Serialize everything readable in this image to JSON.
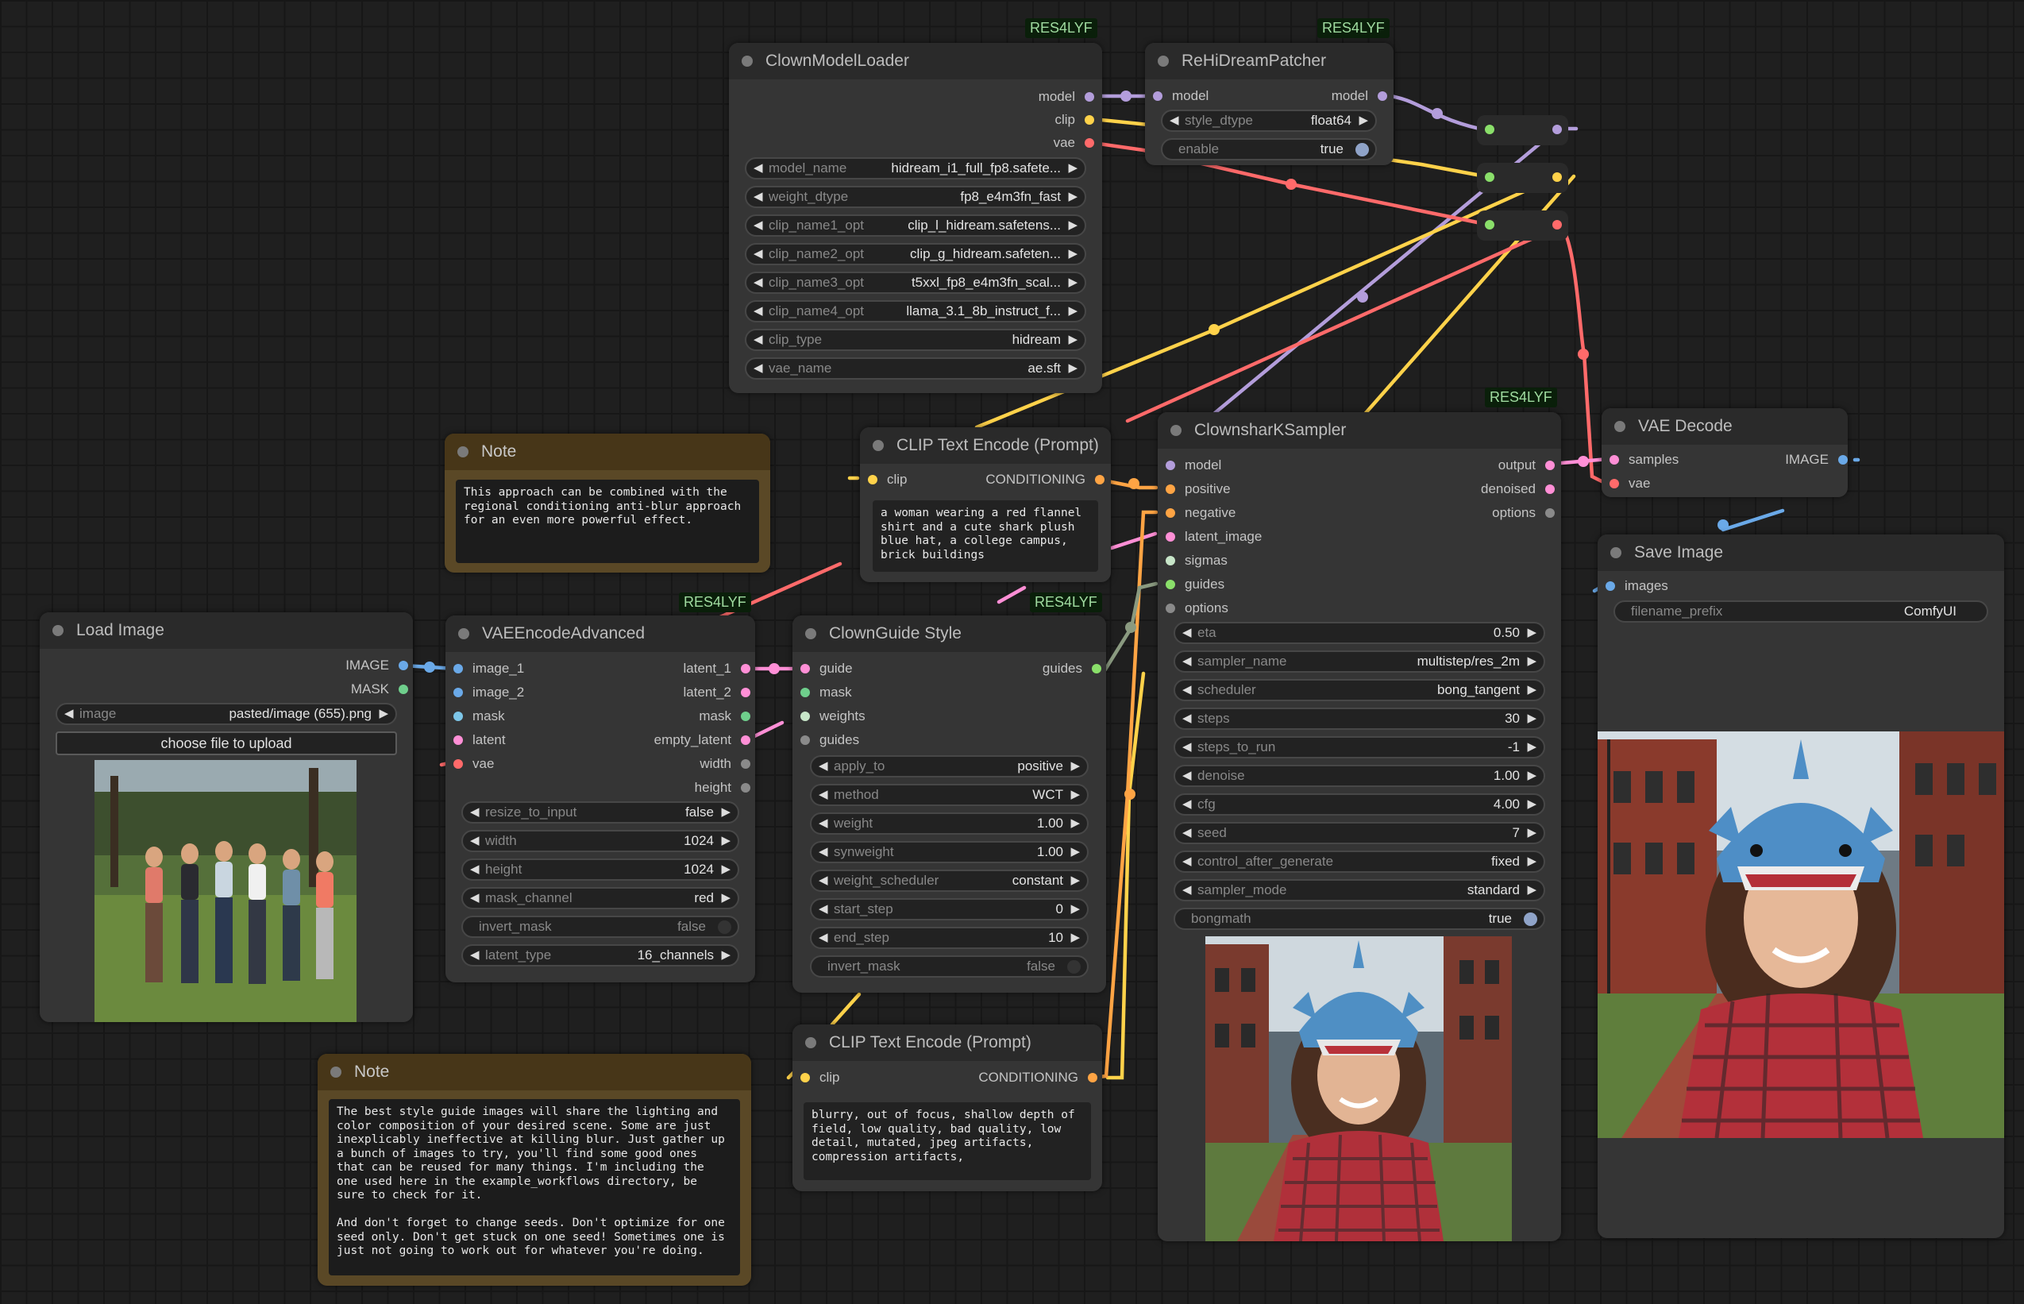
{
  "badges": [
    "RES4LYF",
    "RES4LYF",
    "RES4LYF",
    "RES4LYF",
    "RES4LYF"
  ],
  "clown_model_loader": {
    "title": "ClownModelLoader",
    "outputs": [
      "model",
      "clip",
      "vae"
    ],
    "widgets": [
      {
        "label": "model_name",
        "value": "hidream_i1_full_fp8.safete..."
      },
      {
        "label": "weight_dtype",
        "value": "fp8_e4m3fn_fast"
      },
      {
        "label": "clip_name1_opt",
        "value": "clip_l_hidream.safetens..."
      },
      {
        "label": "clip_name2_opt",
        "value": "clip_g_hidream.safeten..."
      },
      {
        "label": "clip_name3_opt",
        "value": "t5xxl_fp8_e4m3fn_scal..."
      },
      {
        "label": "clip_name4_opt",
        "value": "llama_3.1_8b_instruct_f..."
      },
      {
        "label": "clip_type",
        "value": "hidream"
      },
      {
        "label": "vae_name",
        "value": "ae.sft"
      }
    ]
  },
  "rehidream_patcher": {
    "title": "ReHiDreamPatcher",
    "input": "model",
    "output": "model",
    "widgets": [
      {
        "label": "style_dtype",
        "value": "float64"
      },
      {
        "label": "enable",
        "value": "true"
      }
    ]
  },
  "note_top": {
    "title": "Note",
    "text": "This approach can be combined with the\nregional conditioning anti-blur approach\nfor an even more powerful effect."
  },
  "clip_pos": {
    "title": "CLIP Text Encode (Prompt)",
    "input": "clip",
    "output": "CONDITIONING",
    "text": "a woman wearing a red flannel\nshirt and a cute shark plush\nblue hat, a college campus,\nbrick buildings"
  },
  "clownshark": {
    "title": "ClownsharKSampler",
    "inputs": [
      "model",
      "positive",
      "negative",
      "latent_image",
      "sigmas",
      "guides",
      "options"
    ],
    "outputs": [
      "output",
      "denoised",
      "options"
    ],
    "widgets": [
      {
        "label": "eta",
        "value": "0.50"
      },
      {
        "label": "sampler_name",
        "value": "multistep/res_2m"
      },
      {
        "label": "scheduler",
        "value": "bong_tangent"
      },
      {
        "label": "steps",
        "value": "30"
      },
      {
        "label": "steps_to_run",
        "value": "-1"
      },
      {
        "label": "denoise",
        "value": "1.00"
      },
      {
        "label": "cfg",
        "value": "4.00"
      },
      {
        "label": "seed",
        "value": "7"
      },
      {
        "label": "control_after_generate",
        "value": "fixed"
      },
      {
        "label": "sampler_mode",
        "value": "standard"
      }
    ],
    "toggle": {
      "label": "bongmath",
      "value": "true"
    }
  },
  "vae_decode": {
    "title": "VAE Decode",
    "inputs": [
      "samples",
      "vae"
    ],
    "output": "IMAGE"
  },
  "save_image": {
    "title": "Save Image",
    "input": "images",
    "widget": {
      "label": "filename_prefix",
      "value": "ComfyUI"
    }
  },
  "load_image": {
    "title": "Load Image",
    "outputs": [
      "IMAGE",
      "MASK"
    ],
    "widget": {
      "label": "image",
      "value": "pasted/image (655).png"
    },
    "button": "choose file to upload"
  },
  "vae_encode_adv": {
    "title": "VAEEncodeAdvanced",
    "inputs": [
      "image_1",
      "image_2",
      "mask",
      "latent",
      "vae"
    ],
    "outputs": [
      "latent_1",
      "latent_2",
      "mask",
      "empty_latent",
      "width",
      "height"
    ],
    "widgets": [
      {
        "label": "resize_to_input",
        "value": "false"
      },
      {
        "label": "width",
        "value": "1024"
      },
      {
        "label": "height",
        "value": "1024"
      },
      {
        "label": "mask_channel",
        "value": "red"
      }
    ],
    "toggle": {
      "label": "invert_mask",
      "value": "false"
    },
    "widget_last": {
      "label": "latent_type",
      "value": "16_channels"
    }
  },
  "clown_guide": {
    "title": "ClownGuide Style",
    "inputs": [
      "guide",
      "mask",
      "weights",
      "guides"
    ],
    "output": "guides",
    "widgets": [
      {
        "label": "apply_to",
        "value": "positive"
      },
      {
        "label": "method",
        "value": "WCT"
      },
      {
        "label": "weight",
        "value": "1.00"
      },
      {
        "label": "synweight",
        "value": "1.00"
      },
      {
        "label": "weight_scheduler",
        "value": "constant"
      },
      {
        "label": "start_step",
        "value": "0"
      },
      {
        "label": "end_step",
        "value": "10"
      }
    ],
    "toggle": {
      "label": "invert_mask",
      "value": "false"
    }
  },
  "clip_neg": {
    "title": "CLIP Text Encode (Prompt)",
    "input": "clip",
    "output": "CONDITIONING",
    "text": "blurry, out of focus, shallow depth of\nfield, low quality, bad quality, low\ndetail, mutated, jpeg artifacts,\ncompression artifacts,"
  },
  "note_bottom": {
    "title": "Note",
    "text": "The best style guide images will share the lighting and\ncolor composition of your desired scene. Some are just\ninexplicably ineffective at killing blur. Just gather up\na bunch of images to try, you'll find some good ones\nthat can be reused for many things. I'm including the\none used here in the example_workflows directory, be\nsure to check for it.\n\nAnd don't forget to change seeds. Don't optimize for one\nseed only. Don't get stuck on one seed! Sometimes one is\njust not going to work out for whatever you're doing."
  },
  "colors": {
    "model": "#b39ddb",
    "clip": "#ffd24a",
    "vae": "#ff6a6a",
    "latent": "#ff8fd6",
    "conditioning": "#ffa444",
    "image": "#6aa9e8",
    "guides": "#8adf6a",
    "canvas": "#1f1f1f",
    "node": "#353535"
  }
}
